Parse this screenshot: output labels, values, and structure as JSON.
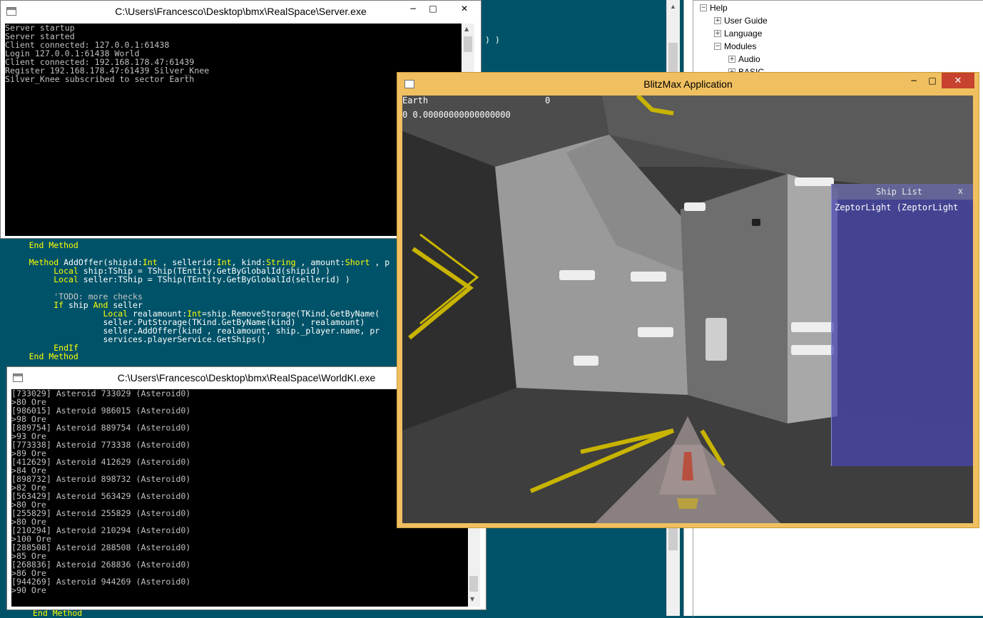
{
  "ide": {
    "fragment_top": ") )",
    "code_lines": [
      {
        "indent": 5,
        "parts": [
          {
            "t": "End Method",
            "k": "kw"
          }
        ]
      },
      {
        "indent": 0,
        "parts": [
          {
            "t": "",
            "k": ""
          }
        ]
      },
      {
        "indent": 5,
        "parts": [
          {
            "t": "Method ",
            "k": "kw"
          },
          {
            "t": "AddOffer(shipid:",
            "k": ""
          },
          {
            "t": "Int",
            "k": "kw"
          },
          {
            "t": " , sellerid:",
            "k": ""
          },
          {
            "t": "Int",
            "k": "kw"
          },
          {
            "t": ", kind:",
            "k": ""
          },
          {
            "t": "String",
            "k": "kw"
          },
          {
            "t": " , amount:",
            "k": ""
          },
          {
            "t": "Short",
            "k": "kw"
          },
          {
            "t": " , p",
            "k": ""
          }
        ]
      },
      {
        "indent": 10,
        "parts": [
          {
            "t": "Local",
            "k": "kw"
          },
          {
            "t": " ship:TShip = TShip(TEntity.GetByGlobalId(shipid) )",
            "k": ""
          }
        ]
      },
      {
        "indent": 10,
        "parts": [
          {
            "t": "Local",
            "k": "kw"
          },
          {
            "t": " seller:TShip = TShip(TEntity.GetByGlobalId(sellerid) )",
            "k": ""
          }
        ]
      },
      {
        "indent": 0,
        "parts": [
          {
            "t": "",
            "k": ""
          }
        ]
      },
      {
        "indent": 10,
        "parts": [
          {
            "t": "'TODO: more checks",
            "k": "cm"
          }
        ]
      },
      {
        "indent": 10,
        "parts": [
          {
            "t": "If",
            "k": "kw"
          },
          {
            "t": " ship ",
            "k": ""
          },
          {
            "t": "And",
            "k": "kw"
          },
          {
            "t": " seller",
            "k": ""
          }
        ]
      },
      {
        "indent": 20,
        "parts": [
          {
            "t": "Local",
            "k": "kw"
          },
          {
            "t": " realamount:",
            "k": ""
          },
          {
            "t": "Int",
            "k": "kw"
          },
          {
            "t": "=ship.RemoveStorage(TKind.GetByName(",
            "k": ""
          }
        ]
      },
      {
        "indent": 20,
        "parts": [
          {
            "t": "seller.PutStorage(TKind.GetByName(kind) , realamount)",
            "k": ""
          }
        ]
      },
      {
        "indent": 20,
        "parts": [
          {
            "t": "seller.AddOffer(kind , realamount, ship._player.name, pr",
            "k": ""
          }
        ]
      },
      {
        "indent": 20,
        "parts": [
          {
            "t": "services.playerService.GetShips()",
            "k": ""
          }
        ]
      },
      {
        "indent": 10,
        "parts": [
          {
            "t": "EndIf",
            "k": "kw"
          }
        ]
      },
      {
        "indent": 5,
        "parts": [
          {
            "t": "End Method",
            "k": "kw"
          }
        ]
      }
    ],
    "bottom_line": "End Method"
  },
  "help_tree": {
    "items": [
      {
        "label": "Help",
        "box": "−",
        "level": 0
      },
      {
        "label": "User Guide",
        "box": "+",
        "level": 1
      },
      {
        "label": "Language",
        "box": "+",
        "level": 1
      },
      {
        "label": "Modules",
        "box": "−",
        "level": 1
      },
      {
        "label": "Audio",
        "box": "+",
        "level": 2
      },
      {
        "label": "BASIC",
        "box": "+",
        "level": 2
      }
    ]
  },
  "server_window": {
    "title": "C:\\Users\\Francesco\\Desktop\\bmx\\RealSpace\\Server.exe",
    "minimize": "−",
    "maximize": "□",
    "close": "✕",
    "lines": [
      "Server startup",
      "Server started",
      "Client connected: 127.0.0.1:61438",
      "Login 127.0.0.1:61438 World",
      "Client connected: 192.168.178.47:61439",
      "Register 192.168.178.47:61439 Silver_Knee",
      "Silver_Knee subscribed to sector Earth"
    ]
  },
  "worldki_window": {
    "title": "C:\\Users\\Francesco\\Desktop\\bmx\\RealSpace\\WorldKI.exe",
    "lines": [
      "[733029] Asteroid 733029 (Asteroid0)",
      ">80 Ore",
      "[986015] Asteroid 986015 (Asteroid0)",
      ">98 Ore",
      "[889754] Asteroid 889754 (Asteroid0)",
      ">93 Ore",
      "[773338] Asteroid 773338 (Asteroid0)",
      ">89 Ore",
      "[412629] Asteroid 412629 (Asteroid0)",
      ">84 Ore",
      "[898732] Asteroid 898732 (Asteroid0)",
      ">82 Ore",
      "[563429] Asteroid 563429 (Asteroid0)",
      ">80 Ore",
      "[255829] Asteroid 255829 (Asteroid0)",
      ">80 Ore",
      "[210294] Asteroid 210294 (Asteroid0)",
      ">100 Ore",
      "[288508] Asteroid 288508 (Asteroid0)",
      ">85 Ore",
      "[268836] Asteroid 268836 (Asteroid0)",
      ">86 Ore",
      "[944269] Asteroid 944269 (Asteroid0)",
      ">90 Ore"
    ]
  },
  "blitz_window": {
    "title": "BlitzMax Application",
    "minimize": "−",
    "maximize": "□",
    "close": "✕",
    "hud": {
      "sector": "Earth",
      "sector_value": "0",
      "debug_line": "0 0.00000000000000000"
    },
    "ship_list": {
      "title": "Ship List",
      "close": "x",
      "entries": [
        "ZeptorLight (ZeptorLight"
      ]
    }
  },
  "colors": {
    "ide_background": "#005268",
    "keyword": "#ffff00",
    "blitz_frame": "#f0c060",
    "close_red": "#c7422f",
    "ship_list_blue": "#4646b4"
  }
}
